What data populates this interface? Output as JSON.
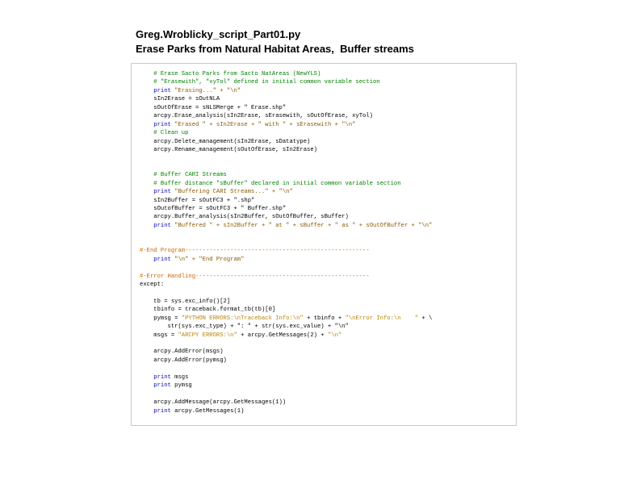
{
  "header": {
    "line1": "Greg.Wroblicky_script_Part01.py",
    "line2": "Erase Parks from Natural Habitat Areas,  Buffer streams"
  },
  "code": {
    "l01": "# Erase Sacto Parks from Sacto NatAreas (NewYLS)",
    "l02": "# \"Erasewith\", \"xyTol\" defined in initial common variable section",
    "l03a": "print",
    "l03b": " \"Erasing...\" + \"\\n\"",
    "l04": "sIn2Erase = sOutNLA",
    "l05": "sOutOfErase = sNLSMerge + \" Erase.shp\"",
    "l06": "arcpy.Erase_analysis(sIn2Erase, sErasewith, sOutOfErase, xyTol)",
    "l07a": "print",
    "l07b": " \"Erased \" + sIn2Erase + \" with \" + sErasewith + \"\\n\"",
    "l08": "# Clean up",
    "l09": "arcpy.Delete_management(sIn2Erase, sDatatype)",
    "l10": "arcpy.Rename_management(sOutOfErase, sIn2Erase)",
    "l13": "# Buffer CARI Streams",
    "l14": "# Buffer distance \"sBuffer\" declared in initial common variable section",
    "l15a": "print",
    "l15b": " \"Buffering CARI Streams...\" + \"\\n\"",
    "l16": "sIn2Buffer = sOutFC3 + \".shp\"",
    "l17": "sOutofBuffer = sOutFC3 + \" Buffer.shp\"",
    "l18": "arcpy.Buffer_analysis(sIn2Buffer, sOutOfBuffer, sBuffer)",
    "l19a": "print",
    "l19b": " \"Buffered \" + sIn2Buffer + \" at \" + sBuffer + \" as \" + sOutOfBuffer + \"\\n\"",
    "l22": "#-End Program-----------------------------------------------------",
    "l23a": "print",
    "l23b": " \"\\n\" + \"End Program\"",
    "l25": "#-Error Handling--------------------------------------------------",
    "l26": "except:",
    "l28": "tb = sys.exc_info()[2]",
    "l29": "tbinfo = traceback.format_tb(tb)[0]",
    "l30a": "pymsg = ",
    "l30b": "\"PYTHON ERRORS:\\nTraceback Info:\\n\"",
    "l30c": " + tbinfo + ",
    "l30d": "\"\\nError Info:\\n    \"",
    "l30e": " + \\",
    "l31": "    str(sys.exc_type) + \": \" + str(sys.exc_value) + \"\\n\"",
    "l32a": "msgs = ",
    "l32b": "\"ARCPY ERRORS:\\n\"",
    "l32c": " + arcpy.GetMessages(2) + ",
    "l32d": "\"\\n\"",
    "l34": "arcpy.AddError(msgs)",
    "l35": "arcpy.AddError(pymsg)",
    "l37a": "print",
    "l37b": " msgs",
    "l38a": "print",
    "l38b": " pymsg",
    "l40": "arcpy.AddMessage(arcpy.GetMessages(1))",
    "l41a": "print",
    "l41b": " arcpy.GetMessages(1)"
  }
}
